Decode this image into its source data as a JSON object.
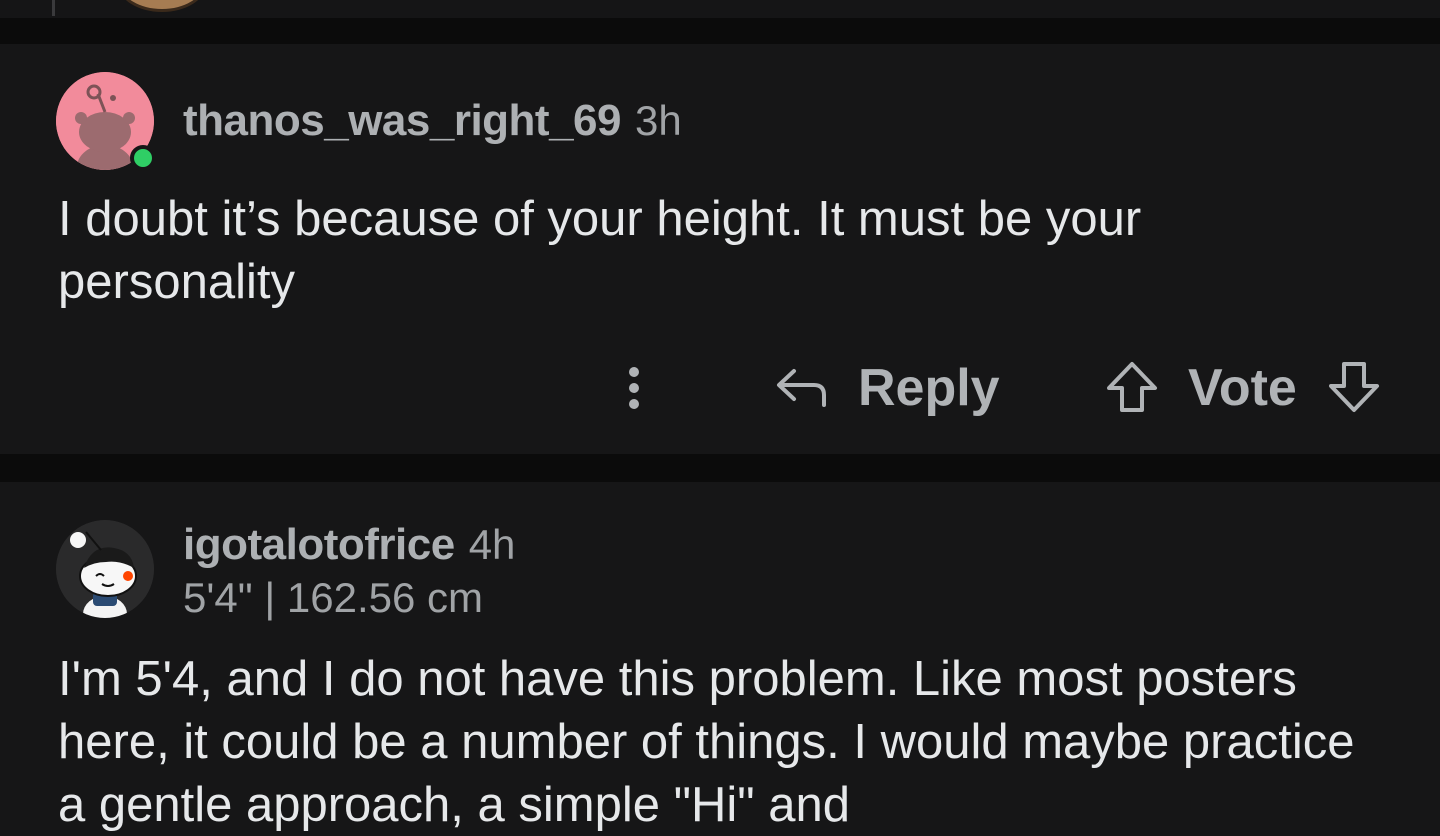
{
  "comments": [
    {
      "username": "thanos_was_right_69",
      "time": "3h",
      "online": true,
      "body": "I doubt it’s because of your height. It must be your personality",
      "actions": {
        "more_icon": "more-vertical-icon",
        "reply_icon": "reply-arrow-icon",
        "reply_label": "Reply",
        "upvote_icon": "upvote-arrow-icon",
        "vote_label": "Vote",
        "downvote_icon": "downvote-arrow-icon"
      }
    },
    {
      "username": "igotalotofrice",
      "time": "4h",
      "flair": "5'4\" | 162.56 cm",
      "body": "I'm 5'4, and I do not have this problem.  Like most posters here, it could be a number of things.  I would maybe practice a gentle approach, a simple \"Hi\" and"
    }
  ],
  "colors": {
    "background": "#0b0b0b",
    "card": "#161617",
    "text": "#e6e8ea",
    "muted_text": "#a0a3a6",
    "online": "#2fce65",
    "avatar_pink": "#f28b9b"
  }
}
